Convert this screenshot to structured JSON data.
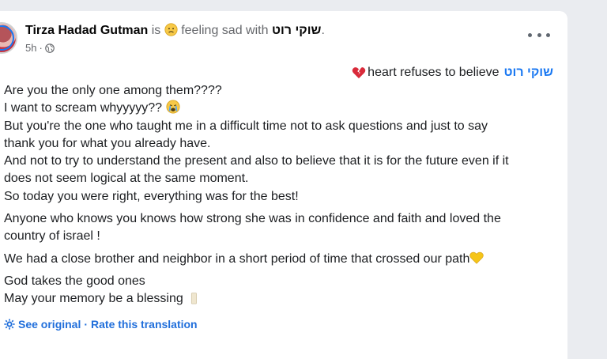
{
  "post": {
    "author": "Tirza Hadad Gutman",
    "verb_is": " is ",
    "feeling": " feeling sad with ",
    "tagged": "שוקי רוט",
    "period": ".",
    "time": "5h",
    "dot": "·",
    "privacy_icon": "globe-icon",
    "more_icon": "more-options-icon"
  },
  "heading_line": {
    "text": "heart refuses to believe",
    "link": "שוקי רוט",
    "emoji": "broken-heart-icon"
  },
  "body": {
    "paragraphs": [
      {
        "lines": [
          "Are you the only one among them????",
          "I want to scream whyyyyy?? ",
          "But you're the one who taught me in a difficult time not to ask questions and just to say",
          "thank you for what you already have.",
          "And not to try to understand the present and also to believe that it is for the future even if it",
          "does not seem logical at the same moment.",
          "So today you were right, everything was for the best!"
        ]
      },
      {
        "lines": [
          "Anyone who knows you knows how strong she was in confidence and faith and loved the",
          "country of israel !"
        ]
      },
      {
        "lines": [
          "We had a close brother and neighbor in a short period of time that crossed our path"
        ]
      },
      {
        "lines": [
          "God takes the good ones",
          "May your memory be a blessing "
        ]
      }
    ]
  },
  "footer": {
    "see_original": "See original",
    "separator": " · ",
    "rate": "Rate this translation",
    "icon": "gear-icon"
  },
  "colors": {
    "link_blue": "#1877f2",
    "footer_blue": "#216fdb",
    "muted_gray": "#65676b",
    "background": "#eaecf0"
  }
}
